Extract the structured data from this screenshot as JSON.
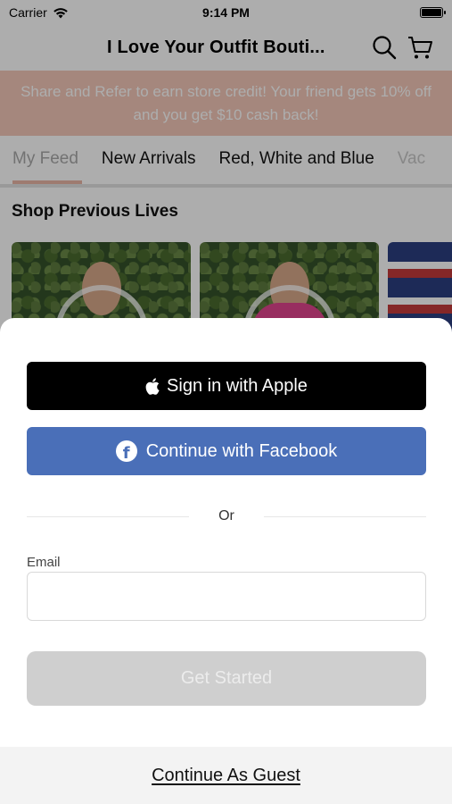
{
  "status_bar": {
    "carrier": "Carrier",
    "time": "9:14 PM"
  },
  "nav": {
    "title": "I Love Your Outfit Bouti...",
    "search_icon": "search-icon",
    "cart_icon": "cart-icon"
  },
  "promo": {
    "text": "Share and Refer to earn store credit!  Your friend gets 10% off and you get $10 cash back!"
  },
  "tabs": [
    {
      "label": "My Feed"
    },
    {
      "label": "New Arrivals"
    },
    {
      "label": "Red, White and Blue"
    },
    {
      "label": "Vac"
    }
  ],
  "section": {
    "title": "Shop Previous Lives"
  },
  "sheet": {
    "apple_button": "Sign in with Apple",
    "facebook_button": "Continue with Facebook",
    "divider_text": "Or",
    "email_label": "Email",
    "email_value": "",
    "email_placeholder": "",
    "get_started_button": "Get Started",
    "guest_link": "Continue As Guest"
  },
  "colors": {
    "promo_bg": "#f3c8b9",
    "facebook_blue": "#4a6fb8",
    "apple_black": "#000000",
    "disabled_gray": "#cfcfcf"
  }
}
